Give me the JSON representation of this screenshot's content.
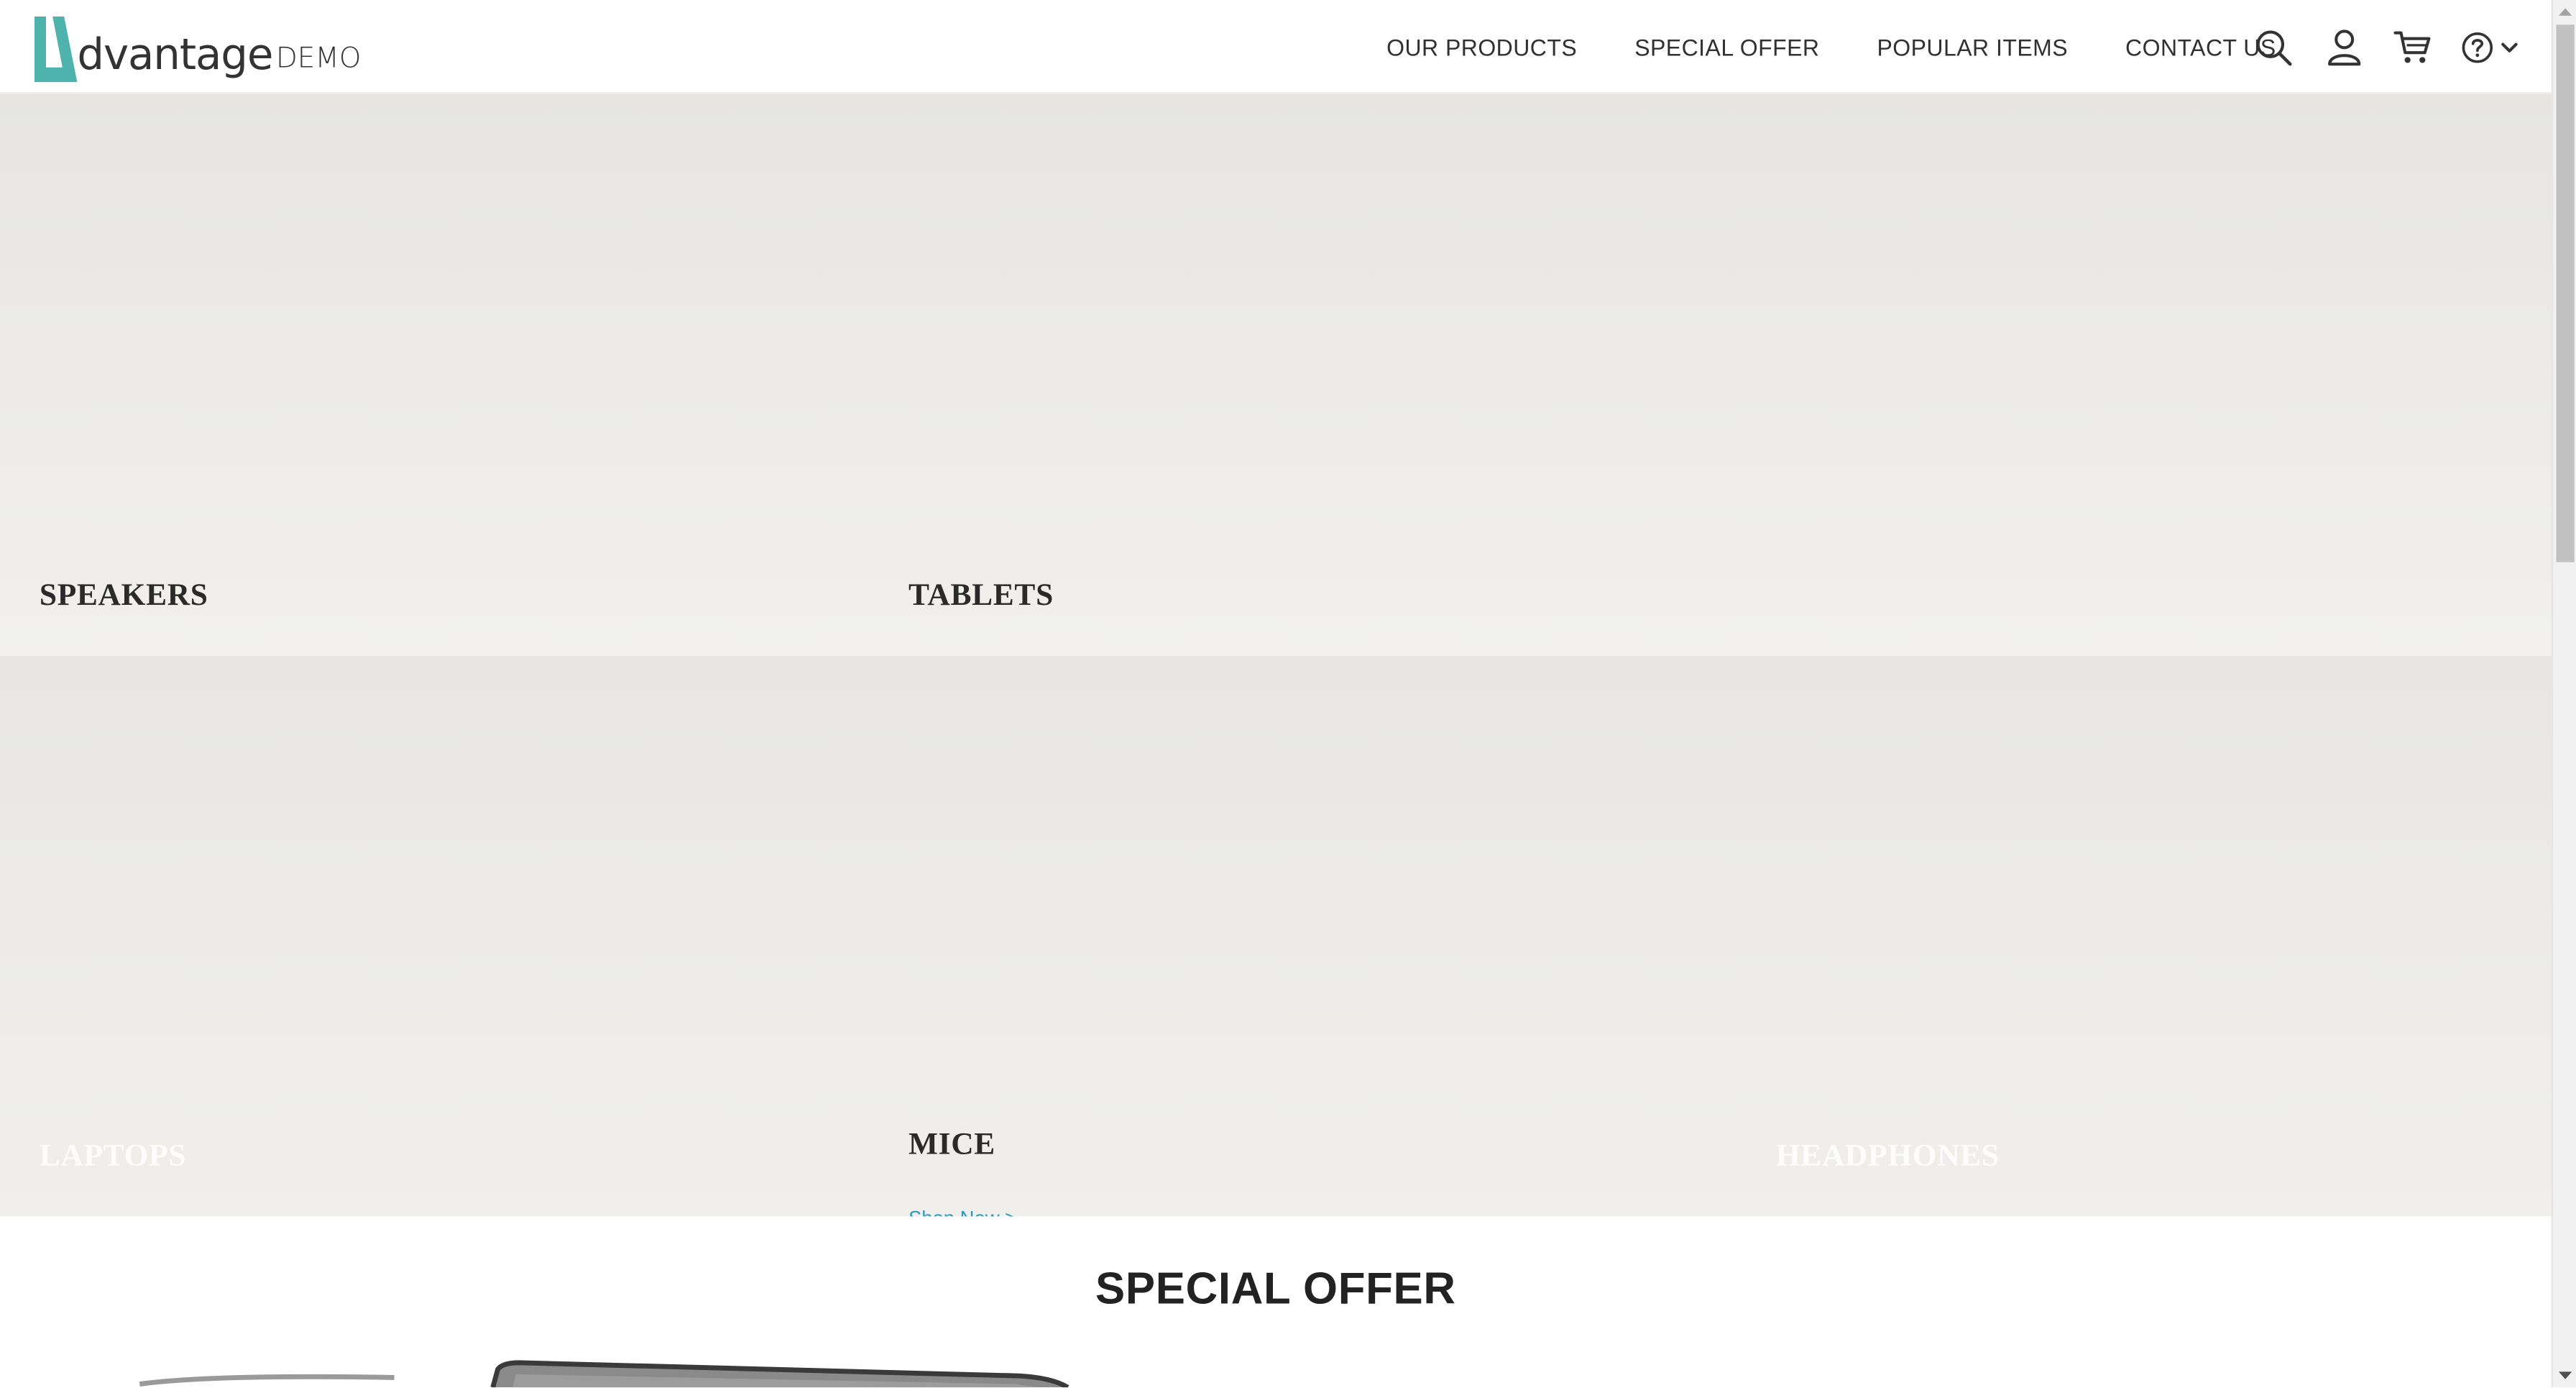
{
  "logo": {
    "word": "dvantage",
    "suffix": "DEMO",
    "brand_color": "#4fb3ad"
  },
  "nav": {
    "items": [
      {
        "label": "OUR PRODUCTS"
      },
      {
        "label": "SPECIAL OFFER"
      },
      {
        "label": "POPULAR ITEMS"
      },
      {
        "label": "CONTACT US"
      }
    ]
  },
  "header_icons": [
    "search-icon",
    "user-icon",
    "cart-icon",
    "help-icon",
    "chevron-down-icon"
  ],
  "categories": {
    "speakers": {
      "title": "SPEAKERS"
    },
    "tablets": {
      "title": "TABLETS"
    },
    "laptops": {
      "title": "LAPTOPS"
    },
    "mice": {
      "title": "MICE",
      "link": "Shop Now >"
    },
    "headphones": {
      "title": "HEADPHONES"
    }
  },
  "special_offer": {
    "title": "SPECIAL OFFER"
  },
  "colors": {
    "accent_link": "#2b9bb8",
    "tile_bg": "#eceae6",
    "text_dark": "#2a2a2a"
  }
}
